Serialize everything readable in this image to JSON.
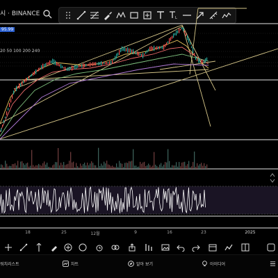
{
  "header": {
    "symbol_text": "시 · BINANCE",
    "price_tag": "95.99",
    "ma_legend": "20 50 100 200 240"
  },
  "toolbar": {
    "items": [
      "move",
      "trend-line",
      "fibonacci",
      "brush",
      "pattern",
      "rectangle",
      "measure",
      "text",
      "text-style",
      "horizontal-line",
      "arrow",
      "ruler",
      "more"
    ]
  },
  "x_axis": {
    "labels": [
      "18",
      "25",
      "12월",
      "9",
      "16",
      "23",
      "2025"
    ]
  },
  "panel_toggles": [
    "chevron-up",
    "chevron-down"
  ],
  "drawing_tools": [
    "crosshair",
    "trend-line",
    "vertical-line",
    "pen",
    "add",
    "circle",
    "alarm",
    "compare",
    "share",
    "bar-settings",
    "image",
    "undo",
    "redo",
    "calendar",
    "indicators",
    "layout"
  ],
  "bottom_nav": {
    "watchlist": "워치리스트",
    "chart": "차트",
    "explore": "알아 보기",
    "ideas": "아이디어",
    "menu": "메뉴"
  },
  "colors": {
    "background": "#000000",
    "price_line": "#e8e8e8",
    "trend_lines": "#d8c88a",
    "up_candle": "#26a69a",
    "down_candle": "#ef5350",
    "ma_20": "#e7c25c",
    "ma_50": "#ef6c6c",
    "ma_100": "#7fc27f",
    "price_tag_bg": "#2a5fcf"
  }
}
